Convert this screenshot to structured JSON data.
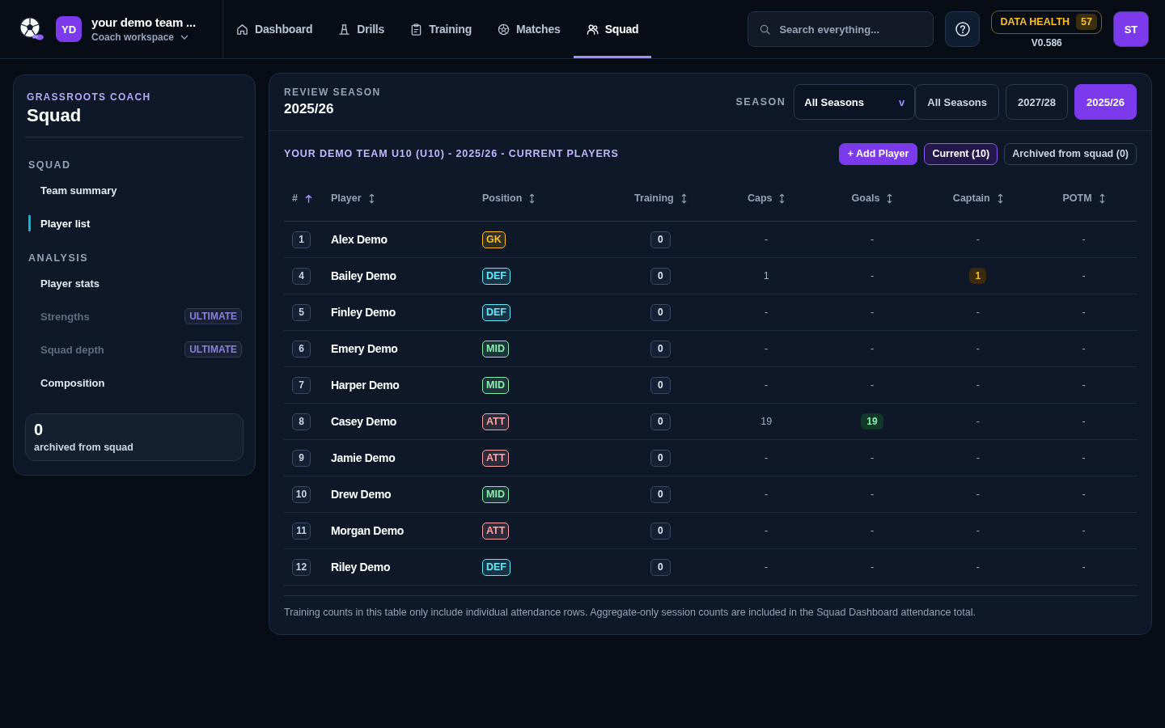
{
  "topbar": {
    "workspace": {
      "initials": "YD",
      "team_name": "your demo team ...",
      "subtitle": "Coach workspace"
    },
    "nav": [
      {
        "label": "Dashboard",
        "selected": false
      },
      {
        "label": "Drills",
        "selected": false
      },
      {
        "label": "Training",
        "selected": false
      },
      {
        "label": "Matches",
        "selected": false
      },
      {
        "label": "Squad",
        "selected": true
      }
    ],
    "search": {
      "placeholder": "Search everything..."
    },
    "data_health": {
      "label": "DATA HEALTH",
      "score": "57"
    },
    "version": "V0.586",
    "user_initials": "ST"
  },
  "sidebar": {
    "eyebrow": "GRASSROOTS COACH",
    "title": "Squad",
    "sections": [
      {
        "heading": "SQUAD",
        "items": [
          {
            "label": "Team summary",
            "selected": false,
            "locked": false
          },
          {
            "label": "Player list",
            "selected": true,
            "locked": false
          }
        ]
      },
      {
        "heading": "ANALYSIS",
        "items": [
          {
            "label": "Player stats",
            "selected": false,
            "locked": false
          },
          {
            "label": "Strengths",
            "selected": false,
            "locked": true,
            "badge": "ULTIMATE"
          },
          {
            "label": "Squad depth",
            "selected": false,
            "locked": true,
            "badge": "ULTIMATE"
          },
          {
            "label": "Composition",
            "selected": false,
            "locked": false
          }
        ]
      }
    ],
    "archived_card": {
      "count": "0",
      "label": "archived from squad"
    }
  },
  "main": {
    "eyebrow": "REVIEW SEASON",
    "season_title": "2025/26",
    "season_label": "SEASON",
    "season_dropdown": {
      "value": "All Seasons",
      "caret": "v"
    },
    "season_buttons": [
      {
        "label": "All Seasons",
        "selected": false
      },
      {
        "label": "2027/28",
        "selected": false
      },
      {
        "label": "2025/26",
        "selected": true
      }
    ],
    "table_title": "YOUR DEMO TEAM U10 (U10) - 2025/26 - CURRENT PLAYERS",
    "add_button": "+ Add Player",
    "filters": [
      {
        "label": "Current (10)",
        "selected": true
      },
      {
        "label": "Archived from squad (0)",
        "selected": false
      }
    ],
    "table": {
      "columns": [
        {
          "label": "#",
          "sorted": true
        },
        {
          "label": "Player",
          "sorted": false
        },
        {
          "label": "Position",
          "sorted": false
        },
        {
          "label": "Training",
          "sorted": false
        },
        {
          "label": "Caps",
          "sorted": false
        },
        {
          "label": "Goals",
          "sorted": false
        },
        {
          "label": "Captain",
          "sorted": false
        },
        {
          "label": "POTM",
          "sorted": false
        }
      ],
      "rows": [
        {
          "number": "1",
          "player": "Alex Demo",
          "position": {
            "label": "GK",
            "color": "#fbbf24"
          },
          "training": "0",
          "caps": "-",
          "goals": {
            "text": "-",
            "highlighted": false
          },
          "captain": {
            "text": "-",
            "highlighted": false
          },
          "potm": "-"
        },
        {
          "number": "4",
          "player": "Bailey Demo",
          "position": {
            "label": "DEF",
            "color": "#67e8f9"
          },
          "training": "0",
          "caps": "1",
          "goals": {
            "text": "-",
            "highlighted": false
          },
          "captain": {
            "text": "1",
            "highlighted": true
          },
          "potm": "-"
        },
        {
          "number": "5",
          "player": "Finley Demo",
          "position": {
            "label": "DEF",
            "color": "#67e8f9"
          },
          "training": "0",
          "caps": "-",
          "goals": {
            "text": "-",
            "highlighted": false
          },
          "captain": {
            "text": "-",
            "highlighted": false
          },
          "potm": "-"
        },
        {
          "number": "6",
          "player": "Emery Demo",
          "position": {
            "label": "MID",
            "color": "#86efac"
          },
          "training": "0",
          "caps": "-",
          "goals": {
            "text": "-",
            "highlighted": false
          },
          "captain": {
            "text": "-",
            "highlighted": false
          },
          "potm": "-"
        },
        {
          "number": "7",
          "player": "Harper Demo",
          "position": {
            "label": "MID",
            "color": "#86efac"
          },
          "training": "0",
          "caps": "-",
          "goals": {
            "text": "-",
            "highlighted": false
          },
          "captain": {
            "text": "-",
            "highlighted": false
          },
          "potm": "-"
        },
        {
          "number": "8",
          "player": "Casey Demo",
          "position": {
            "label": "ATT",
            "color": "#fca5a5"
          },
          "training": "0",
          "caps": "19",
          "goals": {
            "text": "19",
            "highlighted": true
          },
          "captain": {
            "text": "-",
            "highlighted": false
          },
          "potm": "-"
        },
        {
          "number": "9",
          "player": "Jamie Demo",
          "position": {
            "label": "ATT",
            "color": "#fca5a5"
          },
          "training": "0",
          "caps": "-",
          "goals": {
            "text": "-",
            "highlighted": false
          },
          "captain": {
            "text": "-",
            "highlighted": false
          },
          "potm": "-"
        },
        {
          "number": "10",
          "player": "Drew Demo",
          "position": {
            "label": "MID",
            "color": "#86efac"
          },
          "training": "0",
          "caps": "-",
          "goals": {
            "text": "-",
            "highlighted": false
          },
          "captain": {
            "text": "-",
            "highlighted": false
          },
          "potm": "-"
        },
        {
          "number": "11",
          "player": "Morgan Demo",
          "position": {
            "label": "ATT",
            "color": "#fca5a5"
          },
          "training": "0",
          "caps": "-",
          "goals": {
            "text": "-",
            "highlighted": false
          },
          "captain": {
            "text": "-",
            "highlighted": false
          },
          "potm": "-"
        },
        {
          "number": "12",
          "player": "Riley Demo",
          "position": {
            "label": "DEF",
            "color": "#67e8f9"
          },
          "training": "0",
          "caps": "-",
          "goals": {
            "text": "-",
            "highlighted": false
          },
          "captain": {
            "text": "-",
            "highlighted": false
          },
          "potm": "-"
        }
      ]
    },
    "note": "Training counts in this table only include individual attendance rows. Aggregate-only session counts are included in the Squad Dashboard attendance total."
  }
}
